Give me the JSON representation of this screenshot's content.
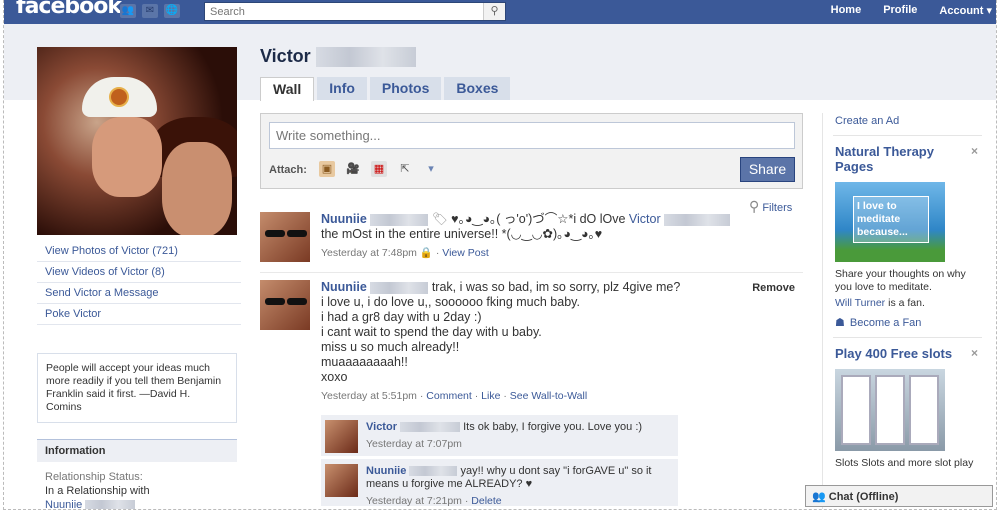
{
  "topbar": {
    "logo": "facebook",
    "search_placeholder": "Search",
    "nav": [
      "Home",
      "Profile",
      "Account ▾"
    ]
  },
  "profile": {
    "first_name": "Victor",
    "tabs": [
      "Wall",
      "Info",
      "Photos",
      "Boxes"
    ],
    "active_tab": "Wall"
  },
  "left": {
    "links": [
      "View Photos of Victor (721)",
      "View Videos of Victor (8)",
      "Send Victor a Message",
      "Poke Victor"
    ],
    "quote": "People will accept your ideas much more readily if you tell them Benjamin Franklin said it first. —David H. Comins",
    "info_header": "Information",
    "relationship_label": "Relationship Status:",
    "relationship_value": "In a Relationship with",
    "partner": "Nuuniie"
  },
  "publisher": {
    "placeholder": "Write something...",
    "attach_label": "Attach:",
    "share_label": "Share"
  },
  "filters_label": "Filters",
  "stories": [
    {
      "author": "Nuuniie",
      "text_a": "♥｡◕‿◕｡( っ'o')づ⌒☆*i dO lOve",
      "mention": "Victor",
      "text_b": "the mOst in the entire universe!! *(◡‿◡✿)｡◕‿◕｡♥",
      "time": "Yesterday at 7:48pm",
      "action": "View Post"
    },
    {
      "author": "Nuuniie",
      "lines": [
        "trak, i was so bad, im so sorry, plz 4give me?",
        "i love u, i do love u,, soooooo fking much baby.",
        "i had a gr8 day with u 2day :)",
        "i cant wait to spend the day with u baby.",
        "miss u so much already!!",
        "muaaaaaaaah!!",
        "xoxo"
      ],
      "remove": "Remove",
      "time": "Yesterday at 5:51pm",
      "actions": [
        "Comment",
        "Like",
        "See Wall-to-Wall"
      ]
    }
  ],
  "comments": [
    {
      "author": "Victor",
      "text": "Its ok baby, I forgive you. Love you :)",
      "time": "Yesterday at 7:07pm"
    },
    {
      "author": "Nuuniie",
      "text": "yay!! why u dont say \"i forGAVE u\" so it means u forgive me ALREADY? ♥",
      "time": "Yesterday at 7:21pm",
      "action": "Delete"
    }
  ],
  "right": {
    "create_ad": "Create an Ad",
    "ad1": {
      "title": "Natural Therapy Pages",
      "img_text": "I love to meditate because...",
      "desc": "Share your thoughts on why you love to meditate.",
      "fan_name": "Will Turner",
      "fan_suffix": "is a fan.",
      "become_fan": "Become a Fan"
    },
    "ad2": {
      "title": "Play 400 Free slots",
      "desc": "Slots Slots and more slot play"
    }
  },
  "chat": "Chat (Offline)"
}
